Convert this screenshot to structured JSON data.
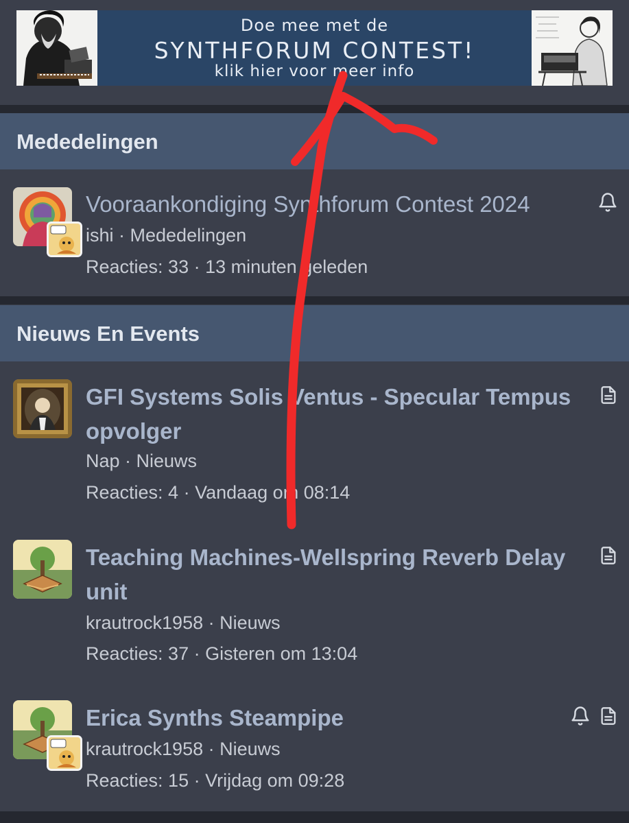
{
  "banner": {
    "line1": "Doe mee met de",
    "line2": "SYNTHFORUM CONTEST!",
    "line3": "klik hier voor meer info"
  },
  "sections": [
    {
      "title": "Mededelingen",
      "threads": [
        {
          "title": "Vooraankondiging Synthforum Contest 2024",
          "author": "ishi",
          "forum": "Mededelingen",
          "replies": "Reacties: 33",
          "time": "13 minuten geleden",
          "icons": [
            "bell-icon"
          ]
        }
      ]
    },
    {
      "title": "Nieuws En Events",
      "threads": [
        {
          "title": "GFI Systems Solis Ventus - Specular Tempus opvolger",
          "author": "Nap",
          "forum": "Nieuws",
          "replies": "Reacties: 4",
          "time": "Vandaag om 08:14",
          "icons": [
            "document-icon"
          ]
        },
        {
          "title": "Teaching Machines-Wellspring Reverb Delay unit",
          "author": "krautrock1958",
          "forum": "Nieuws",
          "replies": "Reacties: 37",
          "time": "Gisteren om 13:04",
          "icons": [
            "document-icon"
          ]
        },
        {
          "title": "Erica Synths Steampipe",
          "author": "krautrock1958",
          "forum": "Nieuws",
          "replies": "Reacties: 15",
          "time": "Vrijdag om 09:28",
          "icons": [
            "bell-icon",
            "document-icon"
          ]
        }
      ]
    }
  ],
  "separator": " · ",
  "colors": {
    "background": "#3b3f4b",
    "section_header": "#465770",
    "banner": "#2a4566",
    "thread_title": "#a9b6cc",
    "annotation_arrow": "#f02a2a"
  }
}
